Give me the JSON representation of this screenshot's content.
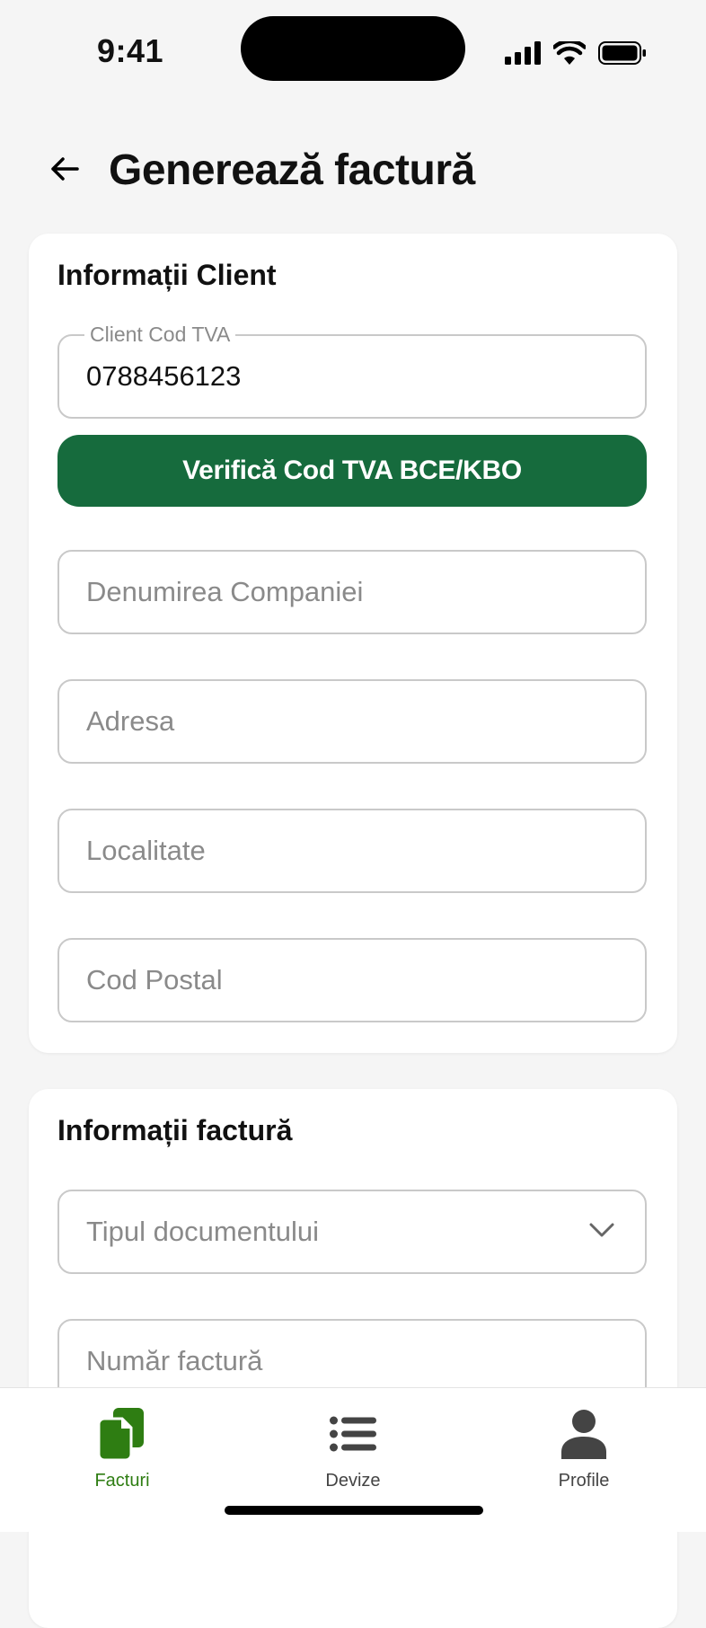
{
  "status_bar": {
    "time": "9:41"
  },
  "header": {
    "title": "Generează factură"
  },
  "client_section": {
    "title": "Informații Client",
    "vat_field": {
      "label": "Client Cod TVA",
      "value": "0788456123"
    },
    "verify_button": "Verifică Cod TVA BCE/KBO",
    "company_placeholder": "Denumirea Companiei",
    "address_placeholder": "Adresa",
    "city_placeholder": "Localitate",
    "postal_placeholder": "Cod Postal"
  },
  "invoice_section": {
    "title": "Informații factură",
    "doc_type_placeholder": "Tipul documentului",
    "invoice_number_placeholder": "Număr factură"
  },
  "tabbar": {
    "tabs": [
      {
        "label": "Facturi",
        "icon": "documents-icon",
        "active": true
      },
      {
        "label": "Devize",
        "icon": "list-icon",
        "active": false
      },
      {
        "label": "Profile",
        "icon": "person-icon",
        "active": false
      }
    ]
  },
  "colors": {
    "primary_green": "#166b3d",
    "tab_active": "#2e7d12",
    "background": "#f5f5f5",
    "field_border": "#c9c9c9"
  }
}
